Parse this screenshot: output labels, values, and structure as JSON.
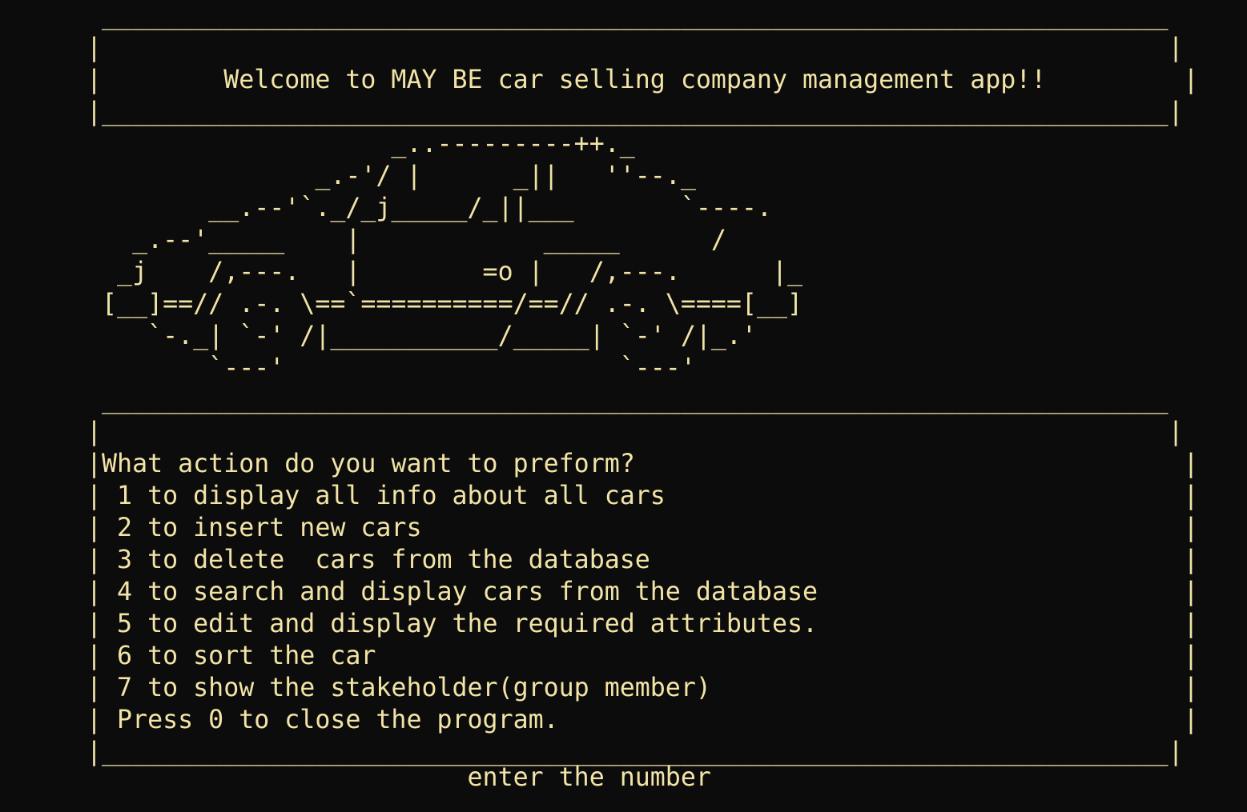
{
  "window": {
    "background": "#0c0c0c",
    "foreground": "#f2e4a6"
  },
  "banner": {
    "border_top": " ______________________________________________________________________",
    "border_empty": "|                                                                      |",
    "title_line": "|        Welcome to MAY BE car selling company management app!!         |",
    "border_bottom": "|______________________________________________________________________|"
  },
  "car_art": [
    "                    _..---------++._",
    "               _.-'/ |      _||   ''--._",
    "        __.--'`._/_j_____/_||___       `----.",
    "   _.--'_____    |            _____      /",
    "  _j    /,---.   |        =o |   /,---.      |_",
    " [__]==// .-. \\==`==========/==// .-. \\====[__]",
    "    `-._| `-' /|___________/_____| `-' /|_.'",
    "        `---'                      `---'"
  ],
  "menu": {
    "border_top": " ______________________________________________________________________",
    "border_empty": "|                                                                      |",
    "lines": [
      "|What action do you want to preform?                                    |",
      "| 1 to display all info about all cars                                  |",
      "| 2 to insert new cars                                                  |",
      "| 3 to delete  cars from the database                                   |",
      "| 4 to search and display cars from the database                        |",
      "| 5 to edit and display the required attributes.                        |",
      "| 6 to sort the car                                                     |",
      "| 7 to show the stakeholder(group member)                               |",
      "| Press 0 to close the program.                                         |"
    ],
    "border_bottom": "|______________________________________________________________________|"
  },
  "prompt": {
    "text": "                         enter the number"
  }
}
